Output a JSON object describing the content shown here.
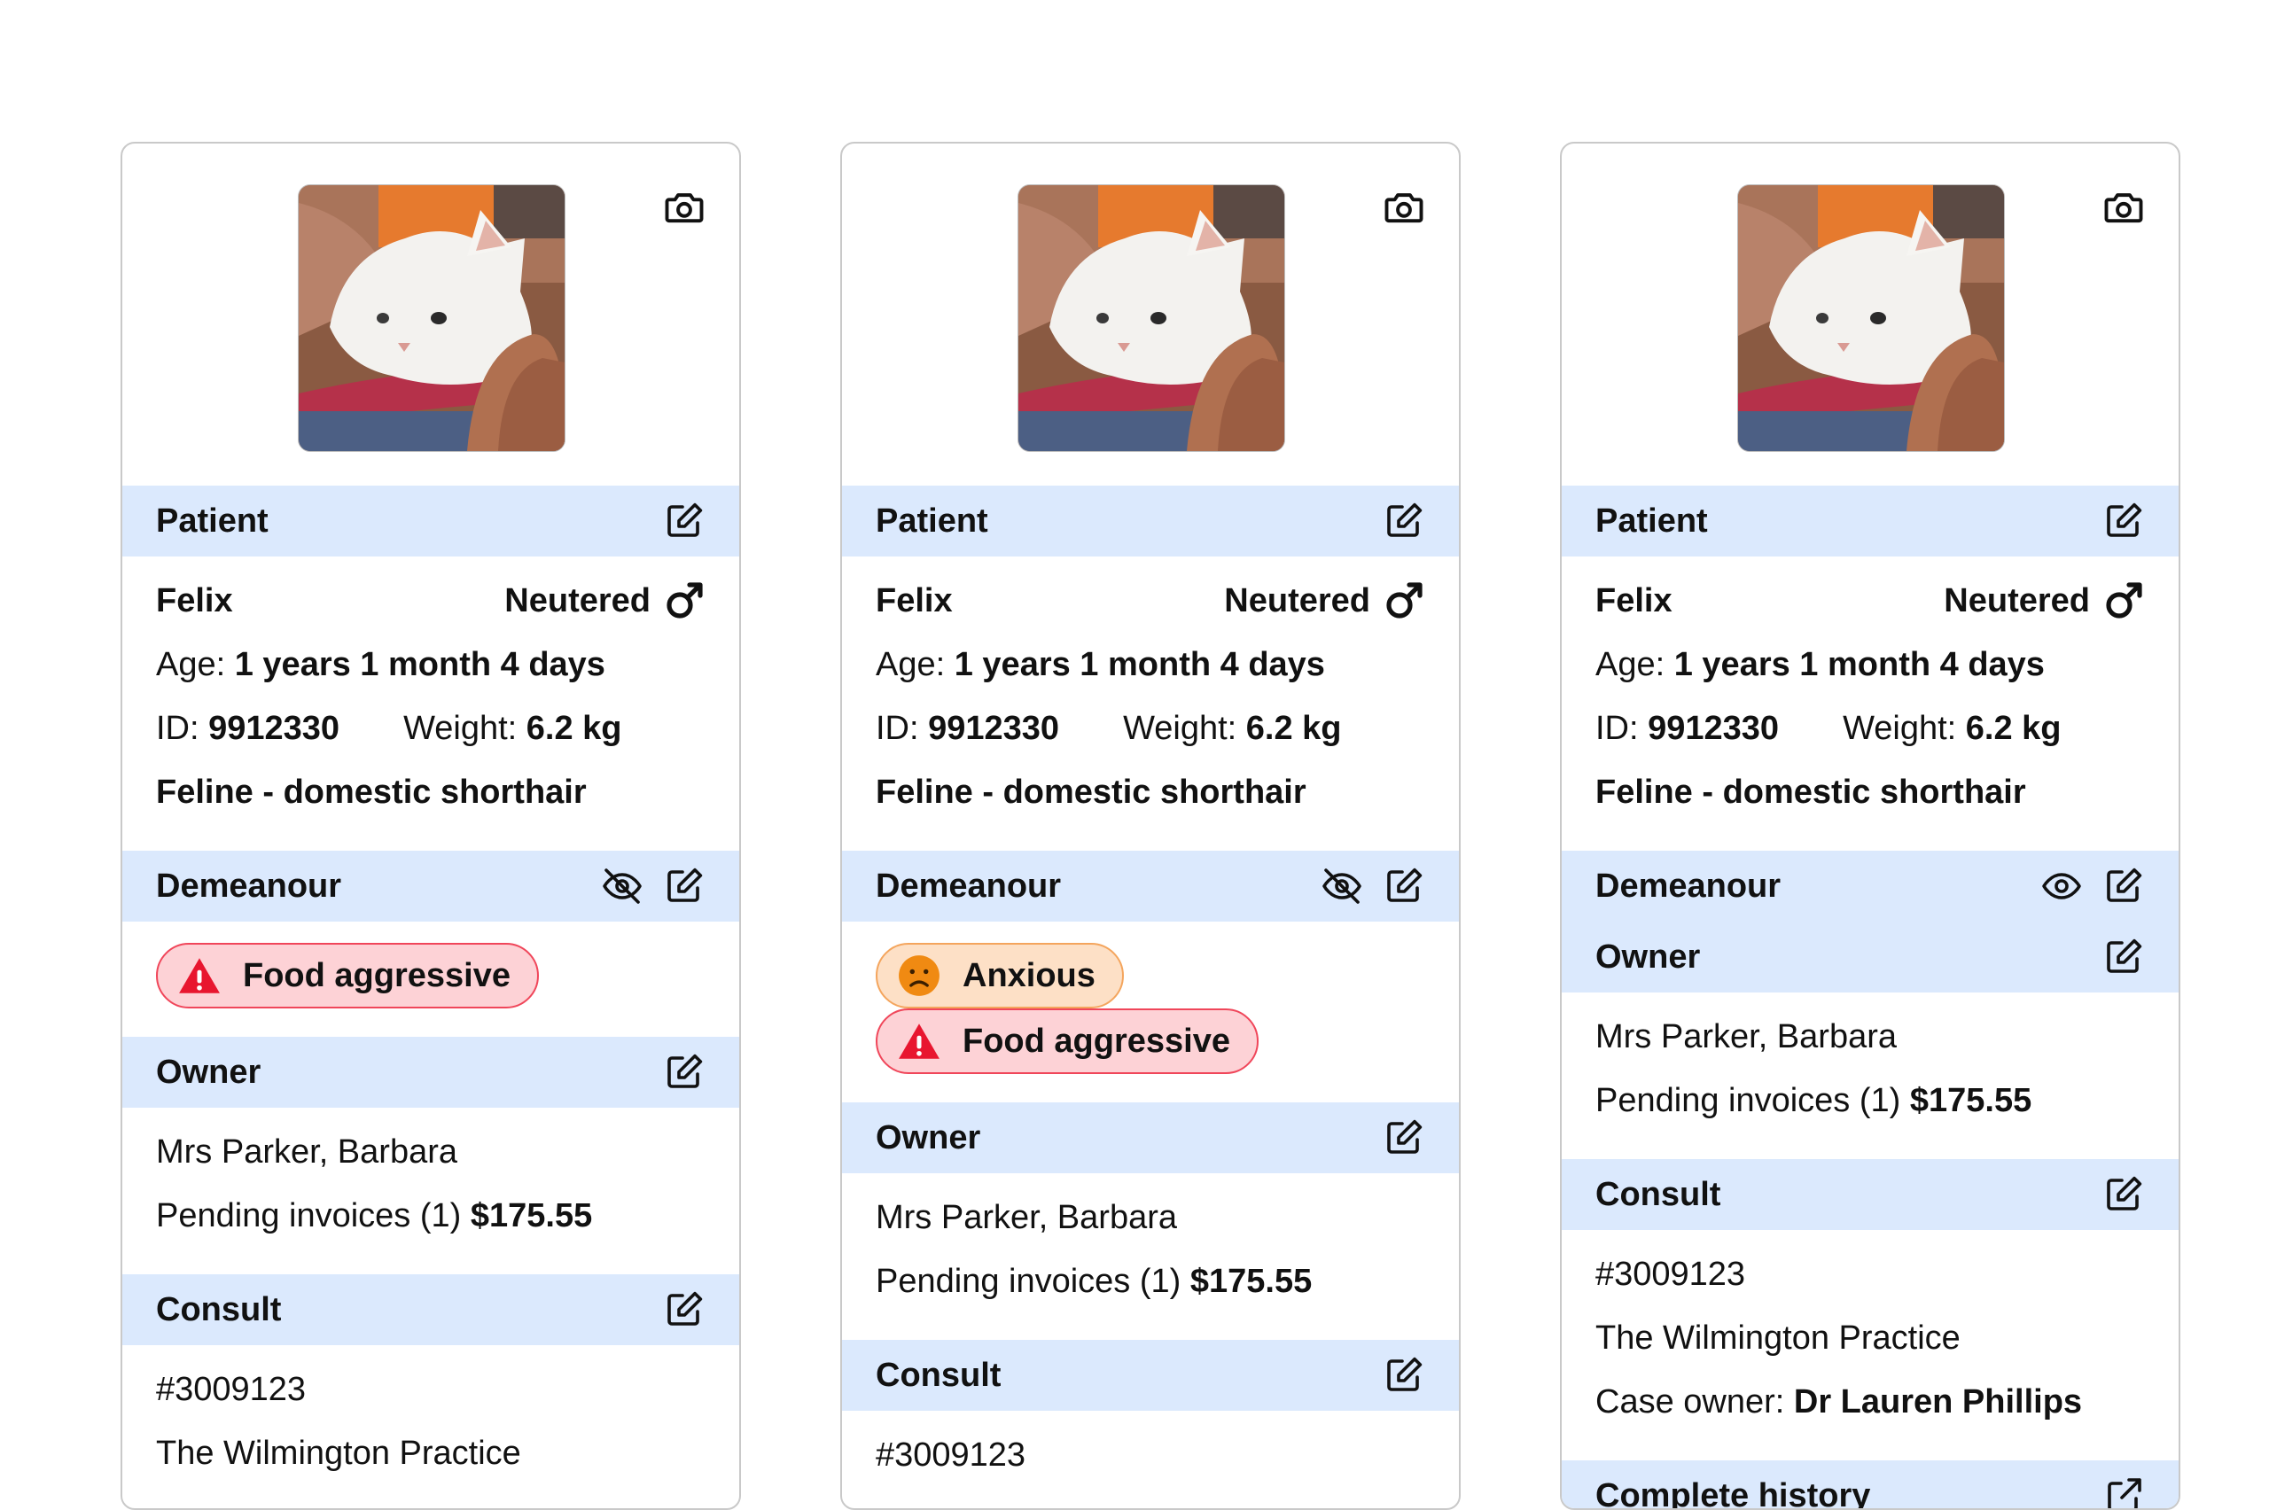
{
  "cards": [
    {
      "demeanour_visibility": "hidden",
      "tags": [
        {
          "type": "alert",
          "icon": "warning-icon",
          "label": "Food aggressive"
        }
      ],
      "consult_lines": [
        "#3009123",
        "The Wilmington Practice"
      ],
      "show_case_owner": false,
      "show_history": false
    },
    {
      "demeanour_visibility": "hidden",
      "tags": [
        {
          "type": "anxious",
          "icon": "sad-face-icon",
          "label": "Anxious"
        },
        {
          "type": "alert",
          "icon": "warning-icon",
          "label": "Food aggressive"
        }
      ],
      "consult_lines": [
        "#3009123"
      ],
      "show_case_owner": false,
      "show_history": false
    },
    {
      "demeanour_visibility": "visible",
      "tags": [],
      "consult_lines": [
        "#3009123",
        "The Wilmington Practice"
      ],
      "show_case_owner": true,
      "show_history": true
    }
  ],
  "patient": {
    "heading": "Patient",
    "name": "Felix",
    "status": "Neutered",
    "age_label": "Age:",
    "age_value": "1 years 1 month 4 days",
    "id_label": "ID:",
    "id_value": "9912330",
    "weight_label": "Weight:",
    "weight_value": "6.2 kg",
    "breed": "Feline - domestic shorthair"
  },
  "demeanour": {
    "heading": "Demeanour"
  },
  "owner": {
    "heading": "Owner",
    "name": "Mrs Parker, Barbara",
    "invoices_label": "Pending invoices (1)",
    "invoices_amount": "$175.55"
  },
  "consult": {
    "heading": "Consult",
    "case_owner_label": "Case owner:",
    "case_owner_value": "Dr Lauren Phillips"
  },
  "history": {
    "heading": "Complete history"
  },
  "colors": {
    "band": "#dbe9fd",
    "alert_bg": "#fdd2d6",
    "alert_border": "#f0465a",
    "alert_icon": "#e8162f",
    "anxious_bg": "#fde0c6",
    "anxious_border": "#f4a55d",
    "anxious_icon": "#f08a12"
  }
}
